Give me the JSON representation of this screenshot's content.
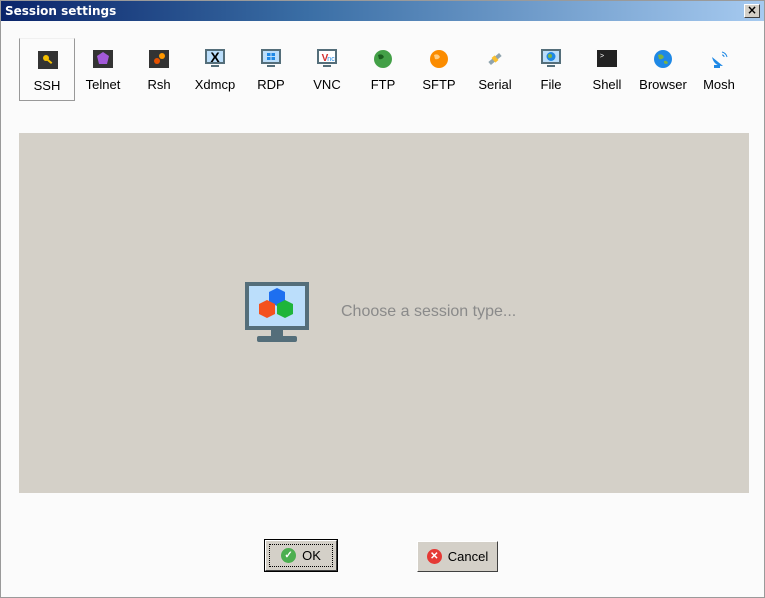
{
  "window": {
    "title": "Session settings",
    "close_label": "×"
  },
  "session_types": [
    {
      "label": "SSH",
      "icon": "key-icon",
      "selected": true
    },
    {
      "label": "Telnet",
      "icon": "gem-icon"
    },
    {
      "label": "Rsh",
      "icon": "gears-icon"
    },
    {
      "label": "Xdmcp",
      "icon": "x-monitor-icon"
    },
    {
      "label": "RDP",
      "icon": "windows-monitor-icon"
    },
    {
      "label": "VNC",
      "icon": "vnc-icon"
    },
    {
      "label": "FTP",
      "icon": "green-globe-icon"
    },
    {
      "label": "SFTP",
      "icon": "orange-globe-icon"
    },
    {
      "label": "Serial",
      "icon": "plug-icon"
    },
    {
      "label": "File",
      "icon": "globe-monitor-icon"
    },
    {
      "label": "Shell",
      "icon": "terminal-icon"
    },
    {
      "label": "Browser",
      "icon": "blue-globe-icon"
    },
    {
      "label": "Mosh",
      "icon": "satellite-dish-icon"
    }
  ],
  "panel": {
    "hint": "Choose a session type..."
  },
  "buttons": {
    "ok": "OK",
    "cancel": "Cancel"
  },
  "colors": {
    "panel": "#d4d0c8",
    "ok": "#4caf50",
    "cancel": "#e53935"
  }
}
